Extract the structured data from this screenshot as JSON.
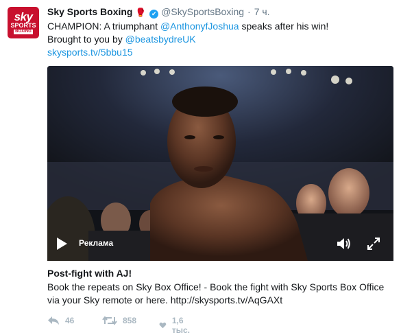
{
  "tweet": {
    "avatar": {
      "line1": "sky",
      "line2": "SPORTS",
      "line3": "BOXING"
    },
    "display_name": "Sky Sports Boxing",
    "name_emoji": "🥊",
    "verified_mark": "✔",
    "handle": "@SkySportsBoxing",
    "separator": "·",
    "timestamp": "7 ч.",
    "text_part1": "CHAMPION: A triumphant ",
    "mention_1": "@AnthonyfJoshua",
    "text_part2": " speaks after his win!",
    "text_part3": "Brought to you by ",
    "mention_2": "@beatsbydreUK",
    "short_link": "skysports.tv/5bbu15"
  },
  "video": {
    "ad_label": "Реклама",
    "icons": [
      "play-icon",
      "volume-icon",
      "expand-icon"
    ]
  },
  "card": {
    "title": "Post-fight with AJ!",
    "description": "Book the repeats on Sky Box Office! - Book the fight with Sky Sports Box Office via your Sky remote or here. http://skysports.tv/AqGAXt"
  },
  "actions": {
    "reply_count": "46",
    "retweet_count": "858",
    "like_count": "1,6 тыс."
  },
  "colors": {
    "link": "#1b95e0",
    "muted": "#657786",
    "action_gray": "#aab8c2",
    "brand_red": "#c8102e",
    "verified_blue": "#1da1f2"
  }
}
